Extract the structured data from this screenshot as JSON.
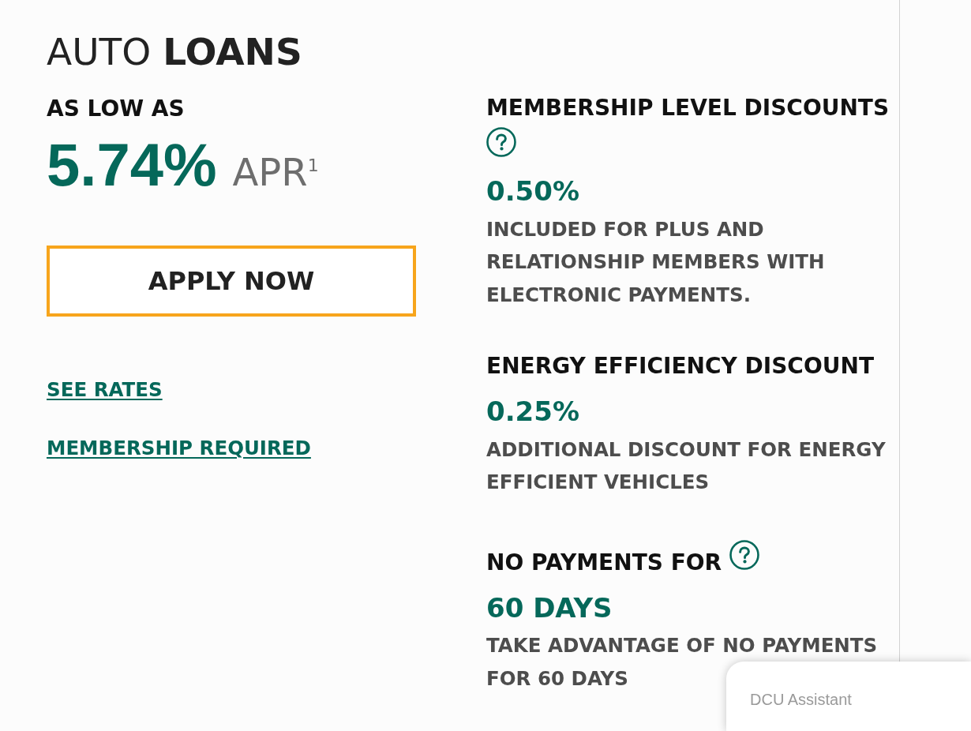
{
  "heading": "AUTO **LOANS**",
  "rate": {
    "label": "AS LOW AS",
    "value": "5.74%",
    "unit": "APR$^{1}$"
  },
  "apply_button": {
    "label": "APPLY NOW"
  },
  "links": [
    "SEE RATES",
    "MEMBERSHIP REQUIRED"
  ],
  "features": [
    {
      "title": "MEMBERSHIP LEVEL DISCOUNTS",
      "help_icon": true,
      "value": "0.50%",
      "description": "INCLUDED FOR PLUS AND RELATIONSHIP MEMBERS WITH ELECTRONIC PAYMENTS."
    },
    {
      "title": "ENERGY EFFICIENCY DISCOUNT",
      "help_icon": false,
      "value": "0.25%",
      "description": "ADDITIONAL DISCOUNT FOR ENERGY EFFICIENT VEHICLES"
    },
    {
      "title": "NO PAYMENTS FOR",
      "help_icon": true,
      "value": "60 DAYS",
      "description": "TAKE ADVANTAGE OF NO PAYMENTS FOR 60 DAYS"
    }
  ],
  "chat_widget": {
    "title": "DCU Assistant"
  }
}
